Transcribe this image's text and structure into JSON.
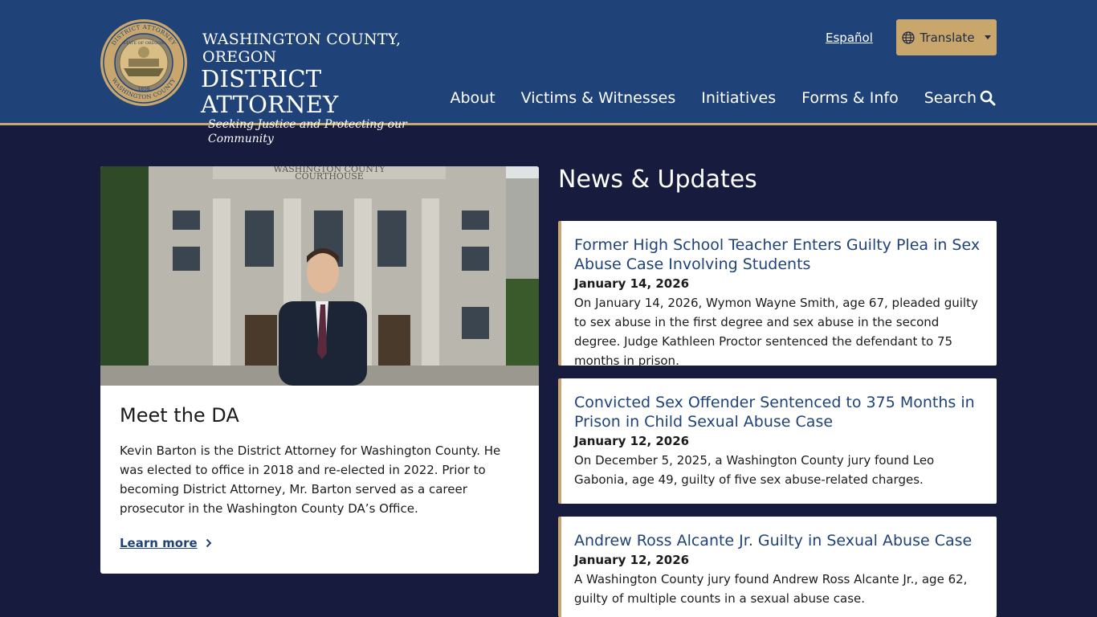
{
  "header": {
    "seal_text_top": "DISTRICT ATTORNEY",
    "seal_text_state": "STATE OF OREGON",
    "seal_text_bottom": "WASHINGTON COUNTY",
    "seal_year": "1859",
    "brand_county": "WASHINGTON COUNTY, OREGON",
    "brand_title": "DISTRICT ATTORNEY",
    "brand_tagline": "Seeking Justice and Protecting our Community",
    "espanol_link": "Español",
    "translate_label": "Translate",
    "nav": [
      {
        "label": "About"
      },
      {
        "label": "Victims & Witnesses"
      },
      {
        "label": "Initiatives"
      },
      {
        "label": "Forms & Info"
      },
      {
        "label": "Search"
      }
    ]
  },
  "da_card": {
    "photo_sign_line1": "WASHINGTON COUNTY",
    "photo_sign_line2": "COURTHOUSE",
    "heading": "Meet the DA",
    "bio": "Kevin Barton is the District Attorney for Washington County. He was elected to office in 2018 and re-elected in 2022. Prior to becoming District Attorney, Mr. Barton served as a career prosecutor in the Washington County DA’s Office.",
    "learn_more": "Learn more"
  },
  "news": {
    "heading": "News & Updates",
    "items": [
      {
        "title": "Former High School Teacher Enters Guilty Plea in Sex Abuse Case Involving Students",
        "date": "January 14, 2026",
        "summary": "On January 14, 2026, Wymon Wayne Smith, age 67, pleaded guilty to sex abuse in the first degree and sex abuse in the second degree. Judge Kathleen Proctor sentenced the defendant to 75 months in prison."
      },
      {
        "title": "Convicted Sex Offender Sentenced to 375 Months in Prison in Child Sexual Abuse Case",
        "date": "January 12, 2026",
        "summary": "On December 5, 2025, a Washington County jury found Leo Gabonia, age 49, guilty of five sex abuse-related charges."
      },
      {
        "title": "Andrew Ross Alcante Jr. Guilty in Sexual Abuse Case",
        "date": "January 12, 2026",
        "summary": "A Washington County jury found Andrew Ross Alcante Jr., age 62, guilty of multiple counts in a sexual abuse case."
      }
    ]
  },
  "colors": {
    "header_bg": "#1f4379",
    "page_bg": "#171b3d",
    "accent_gold": "#c9a66b",
    "link_blue": "#1f4379"
  },
  "icons": [
    "seal-logo",
    "globe-icon",
    "caret-down-icon",
    "search-icon",
    "chevron-right-icon"
  ]
}
